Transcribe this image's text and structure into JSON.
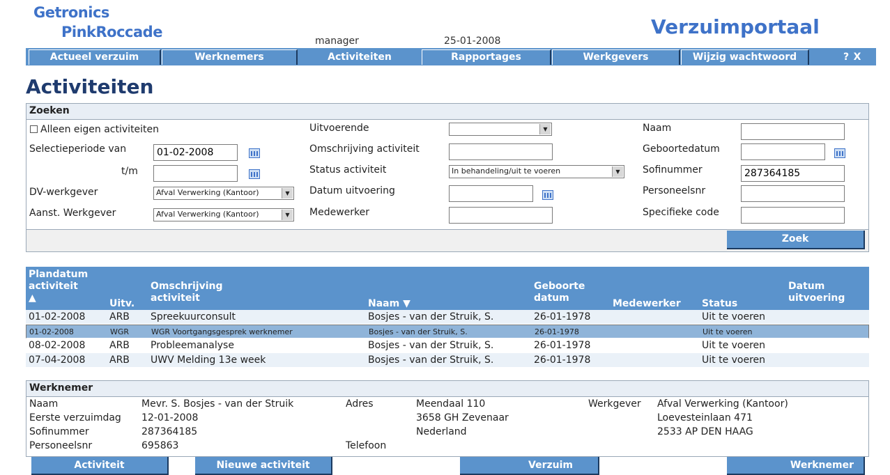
{
  "header": {
    "logo_line1": "Getronics",
    "logo_line2": "PinkRoccade",
    "user": "manager",
    "date": "25-01-2008",
    "brand": "Verzuimportaal"
  },
  "nav": {
    "items": [
      "Actueel verzuim",
      "Werknemers",
      "Activiteiten",
      "Rapportages",
      "Werkgevers",
      "Wijzig wachtwoord"
    ],
    "help": "?",
    "close": "X"
  },
  "page_title": "Activiteiten",
  "search": {
    "header": "Zoeken",
    "own_only_label": "Alleen eigen activiteiten",
    "period_from_label": "Selectieperiode van",
    "period_from_value": "01-02-2008",
    "period_to_label": "t/m",
    "period_to_value": "",
    "dv_employer_label": "DV-werkgever",
    "dv_employer_value": "Afval Verwerking (Kantoor)",
    "aanst_employer_label": "Aanst. Werkgever",
    "aanst_employer_value": "Afval Verwerking (Kantoor)",
    "executing_label": "Uitvoerende",
    "executing_value": "",
    "description_label": "Omschrijving activiteit",
    "description_value": "",
    "status_label": "Status activiteit",
    "status_value": "In behandeling/uit te voeren",
    "exec_date_label": "Datum uitvoering",
    "exec_date_value": "",
    "employee_label": "Medewerker",
    "employee_value": "",
    "name_label": "Naam",
    "name_value": "",
    "birthdate_label": "Geboortedatum",
    "birthdate_value": "",
    "sofi_label": "Sofinummer",
    "sofi_value": "287364185",
    "persnr_label": "Personeelsnr",
    "persnr_value": "",
    "code_label": "Specifieke code",
    "code_value": "",
    "search_button": "Zoek"
  },
  "results": {
    "headers": {
      "plandate": [
        "Plandatum",
        "activiteit",
        "▲"
      ],
      "exec": "Uitv.",
      "desc": [
        "Omschrijving",
        "activiteit"
      ],
      "name": "Naam ▼",
      "birth": [
        "Geboorte",
        "datum"
      ],
      "employee": "Medewerker",
      "status": "Status",
      "execdate": [
        "Datum",
        "uitvoering"
      ]
    },
    "rows": [
      {
        "date": "01-02-2008",
        "exec": "ARB",
        "desc": "Spreekuurconsult",
        "name": "Bosjes - van der Struik, S.",
        "birth": "26-01-1978",
        "employee": "",
        "status": "Uit te voeren",
        "execdate": ""
      },
      {
        "date": "01-02-2008",
        "exec": "WGR",
        "desc": "WGR Voortgangsgesprek werknemer",
        "name": "Bosjes - van der Struik, S.",
        "birth": "26-01-1978",
        "employee": "",
        "status": "Uit te voeren",
        "execdate": ""
      },
      {
        "date": "08-02-2008",
        "exec": "ARB",
        "desc": "Probleemanalyse",
        "name": "Bosjes - van der Struik, S.",
        "birth": "26-01-1978",
        "employee": "",
        "status": "Uit te voeren",
        "execdate": ""
      },
      {
        "date": "07-04-2008",
        "exec": "ARB",
        "desc": "UWV Melding 13e week",
        "name": "Bosjes - van der Struik, S.",
        "birth": "26-01-1978",
        "employee": "",
        "status": "Uit te voeren",
        "execdate": ""
      }
    ]
  },
  "employee": {
    "header": "Werknemer",
    "name_label": "Naam",
    "name_value": "Mevr. S. Bosjes - van der Struik",
    "first_day_label": "Eerste verzuimdag",
    "first_day_value": "12-01-2008",
    "sofi_label": "Sofinummer",
    "sofi_value": "287364185",
    "persnr_label": "Personeelsnr",
    "persnr_value": "695863",
    "address_label": "Adres",
    "address_line1": "Meendaal 110",
    "address_line2": "3658 GH Zevenaar",
    "address_line3": "Nederland",
    "phone_label": "Telefoon",
    "employer_label": "Werkgever",
    "employer_line1": "Afval Verwerking (Kantoor)",
    "employer_line2": "Loevesteinlaan 471",
    "employer_line3": "2533 AP DEN HAAG"
  },
  "footer_buttons": [
    "Activiteit",
    "Nieuwe activiteit",
    "Verzuim",
    "Werknemer"
  ]
}
